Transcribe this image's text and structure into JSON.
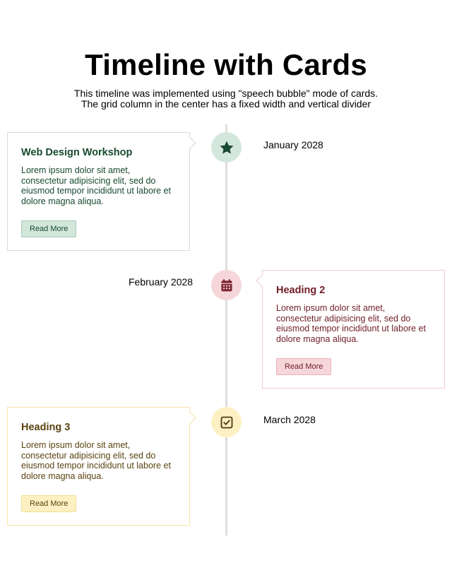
{
  "header": {
    "title": "Timeline with Cards",
    "subtitle_line1": "This timeline was implemented using \"speech bubble\" mode of cards.",
    "subtitle_line2": "The grid column in the center has a fixed width and vertical divider"
  },
  "events": [
    {
      "date": "January 2028",
      "heading": "Web Design Workshop",
      "body": "Lorem ipsum dolor sit amet, consectetur adipisicing elit, sed do eiusmod tempor incididunt ut labore et dolore magna aliqua.",
      "button_label": "Read More",
      "icon": "star-icon",
      "colors": {
        "text": "#174a2f",
        "border": "#cfe1d7",
        "node_bg": "#d4e7dc",
        "icon": "#174a2f",
        "btn_bg": "#d2e6da",
        "btn_border": "#a8cbb6",
        "btn_text": "#174a2f"
      }
    },
    {
      "date": "February 2028",
      "heading": "Heading 2",
      "body": "Lorem ipsum dolor sit amet, consectetur adipisicing elit, sed do eiusmod tempor incididunt ut labore et dolore magna aliqua.",
      "button_label": "Read More",
      "icon": "calendar-icon",
      "colors": {
        "text": "#6f1d28",
        "border": "#f1cbd0",
        "node_bg": "#f6d6d9",
        "icon": "#7a2330",
        "btn_bg": "#f6d6d9",
        "btn_border": "#eab3ba",
        "btn_text": "#6f1d28"
      }
    },
    {
      "date": "March 2028",
      "heading": "Heading 3",
      "body": "Lorem ipsum dolor sit amet, consectetur adipisicing elit, sed do eiusmod tempor incididunt ut labore et dolore magna aliqua.",
      "button_label": "Read More",
      "icon": "check-square-icon",
      "colors": {
        "text": "#5a4310",
        "border": "#f5e3a9",
        "node_bg": "#fdf1c3",
        "icon": "#4a3a10",
        "btn_bg": "#fdf1c3",
        "btn_border": "#f2dd96",
        "btn_text": "#5a4310"
      }
    }
  ]
}
